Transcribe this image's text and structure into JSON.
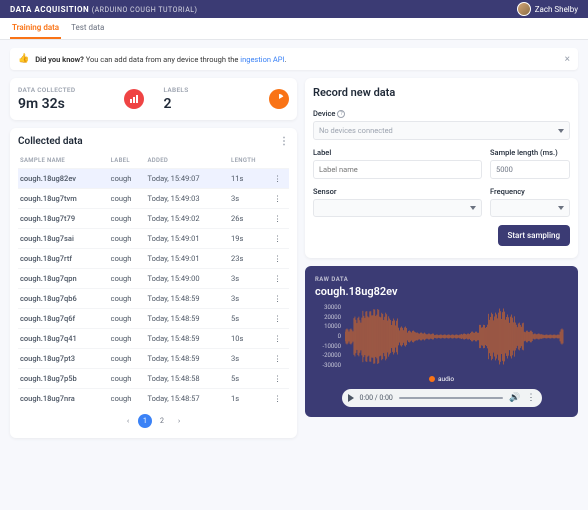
{
  "header": {
    "title": "DATA ACQUISITION",
    "subtitle": "(ARDUINO COUGH TUTORIAL)",
    "user": "Zach Shelby"
  },
  "tabs": {
    "training": "Training data",
    "test": "Test data"
  },
  "banner": {
    "bold": "Did you know?",
    "text": " You can add data from any device through the ",
    "link": "ingestion API",
    "dot": "."
  },
  "stats": {
    "collected_label": "DATA COLLECTED",
    "collected_value": "9m 32s",
    "labels_label": "LABELS",
    "labels_value": "2"
  },
  "collected": {
    "title": "Collected data",
    "columns": {
      "name": "Sample Name",
      "label": "Label",
      "added": "Added",
      "length": "Length"
    },
    "rows": [
      {
        "name": "cough.18ug82ev",
        "label": "cough",
        "added": "Today, 15:49:07",
        "len": "11s"
      },
      {
        "name": "cough.18ug7tvm",
        "label": "cough",
        "added": "Today, 15:49:03",
        "len": "3s"
      },
      {
        "name": "cough.18ug7t79",
        "label": "cough",
        "added": "Today, 15:49:02",
        "len": "26s"
      },
      {
        "name": "cough.18ug7sai",
        "label": "cough",
        "added": "Today, 15:49:01",
        "len": "19s"
      },
      {
        "name": "cough.18ug7rtf",
        "label": "cough",
        "added": "Today, 15:49:01",
        "len": "23s"
      },
      {
        "name": "cough.18ug7qpn",
        "label": "cough",
        "added": "Today, 15:49:00",
        "len": "3s"
      },
      {
        "name": "cough.18ug7qb6",
        "label": "cough",
        "added": "Today, 15:48:59",
        "len": "3s"
      },
      {
        "name": "cough.18ug7q6f",
        "label": "cough",
        "added": "Today, 15:48:59",
        "len": "5s"
      },
      {
        "name": "cough.18ug7q41",
        "label": "cough",
        "added": "Today, 15:48:59",
        "len": "10s"
      },
      {
        "name": "cough.18ug7pt3",
        "label": "cough",
        "added": "Today, 15:48:59",
        "len": "3s"
      },
      {
        "name": "cough.18ug7p5b",
        "label": "cough",
        "added": "Today, 15:48:58",
        "len": "5s"
      },
      {
        "name": "cough.18ug7nra",
        "label": "cough",
        "added": "Today, 15:48:57",
        "len": "1s"
      }
    ],
    "page1": "1",
    "page2": "2"
  },
  "record": {
    "title": "Record new data",
    "device_label": "Device",
    "device_value": "No devices connected",
    "label_label": "Label",
    "label_placeholder": "Label name",
    "length_label": "Sample length (ms.)",
    "length_value": "5000",
    "sensor_label": "Sensor",
    "freq_label": "Frequency",
    "button": "Start sampling"
  },
  "raw": {
    "label": "RAW DATA",
    "name": "cough.18ug82ev",
    "legend": "audio",
    "time": "0:00 / 0:00",
    "yticks": [
      "30000",
      "20000",
      "10000",
      "0",
      "-10000",
      "-20000",
      "-30000"
    ]
  }
}
